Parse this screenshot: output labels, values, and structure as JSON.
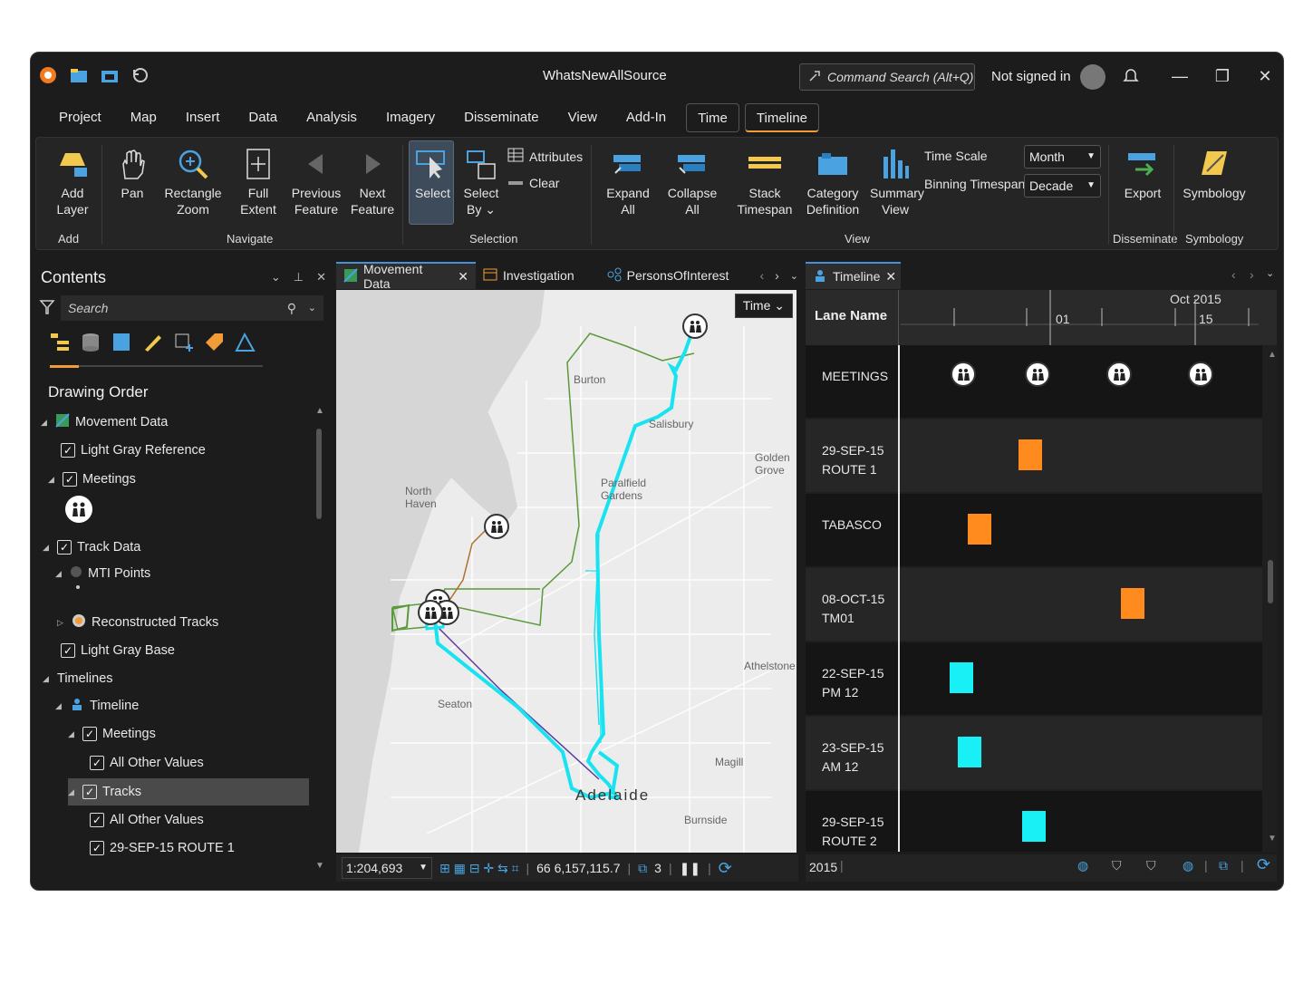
{
  "app": {
    "title": "WhatsNewAllSource",
    "command_search": "Command Search (Alt+Q)",
    "signin": "Not signed in"
  },
  "menu": {
    "tabs": [
      "Project",
      "Map",
      "Insert",
      "Data",
      "Analysis",
      "Imagery",
      "Disseminate",
      "View",
      "Add-In"
    ],
    "context_tabs": [
      "Time",
      "Timeline"
    ],
    "active": "Timeline"
  },
  "ribbon": {
    "add_layer": [
      "Add",
      "Layer"
    ],
    "add_group": "Add",
    "pan": "Pan",
    "rect_zoom": [
      "Rectangle",
      "Zoom"
    ],
    "full_extent": [
      "Full",
      "Extent"
    ],
    "prev_feature": [
      "Previous",
      "Feature"
    ],
    "next_feature": [
      "Next",
      "Feature"
    ],
    "navigate_group": "Navigate",
    "select": "Select",
    "select_by": [
      "Select",
      "By"
    ],
    "attributes": "Attributes",
    "clear": "Clear",
    "selection_group": "Selection",
    "expand_all": [
      "Expand",
      "All"
    ],
    "collapse_all": [
      "Collapse",
      "All"
    ],
    "stack_timespan": [
      "Stack",
      "Timespan"
    ],
    "category_def": [
      "Category",
      "Definition"
    ],
    "summary_view": [
      "Summary",
      "View"
    ],
    "time_scale_label": "Time Scale",
    "time_scale_value": "Month",
    "binning_label": "Binning Timespan",
    "binning_value": "Decade",
    "view_group": "View",
    "export": "Export",
    "disseminate_group": "Disseminate",
    "symbology": "Symbology",
    "symbology_group": "Symbology"
  },
  "contents": {
    "title": "Contents",
    "search_placeholder": "Search",
    "drawing_order": "Drawing Order",
    "items": {
      "movement_data": "Movement Data",
      "light_gray_ref": "Light Gray Reference",
      "meetings": "Meetings",
      "track_data": "Track Data",
      "mti_points": "MTI Points",
      "recon_tracks": "Reconstructed Tracks",
      "light_gray_base": "Light Gray Base",
      "timelines": "Timelines",
      "timeline": "Timeline",
      "meetings2": "Meetings",
      "all_other_1": "All Other Values",
      "tracks": "Tracks",
      "all_other_2": "All Other Values",
      "route1": "29-SEP-15 ROUTE 1"
    }
  },
  "map": {
    "tabs": [
      "Movement Data",
      "Investigation",
      "PersonsOfInterest"
    ],
    "time_button": "Time",
    "labels": [
      "Burton",
      "Salisbury",
      "Golden Grove",
      "Paralfield Gardens",
      "North Haven",
      "Athelstone",
      "Seaton",
      "Magill",
      "Adelaide",
      "Burnside"
    ],
    "scale": "1:204,693",
    "coords": "66 6,157,115.7",
    "selected_count": "3"
  },
  "timeline": {
    "tab": "Timeline",
    "lane_header": "Lane Name",
    "month_label": "Oct 2015",
    "tick_01": "01",
    "tick_15": "15",
    "lanes": [
      {
        "l1": "MEETINGS",
        "l2": ""
      },
      {
        "l1": "29-SEP-15",
        "l2": "ROUTE 1"
      },
      {
        "l1": "TABASCO",
        "l2": ""
      },
      {
        "l1": "08-OCT-15",
        "l2": "TM01"
      },
      {
        "l1": "22-SEP-15",
        "l2": "PM 12"
      },
      {
        "l1": "23-SEP-15",
        "l2": "AM 12"
      },
      {
        "l1": "29-SEP-15",
        "l2": "ROUTE 2"
      }
    ],
    "status_year": "2015",
    "colors": {
      "orange": "#ff8a1e",
      "cyan": "#19f0f5"
    }
  }
}
